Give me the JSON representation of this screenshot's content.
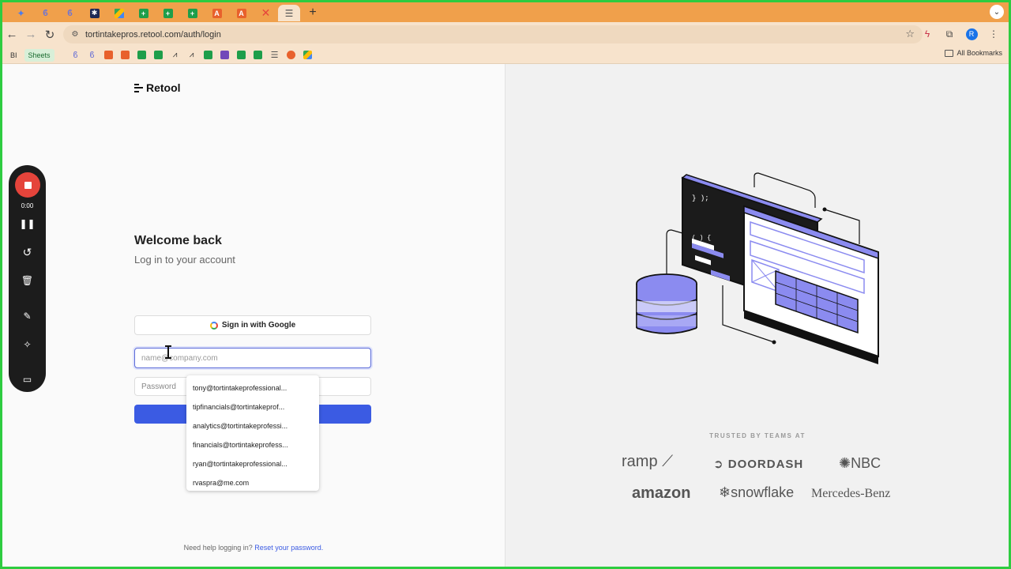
{
  "browser": {
    "tabs": [
      "Gemini",
      "Claude",
      "Claude",
      "Zapier",
      "Drive",
      "Sheets",
      "Sheets",
      "Sheets",
      "Acrobat",
      "Acrobat",
      "Close tab",
      "Retool"
    ],
    "new_tab": "+",
    "tab_menu": "⌄",
    "url": "tortintakepros.retool.com/auth/login",
    "avatar": "R",
    "bookmarks": {
      "first": "BI",
      "sheets": "Sheets",
      "all_bookmarks": "All Bookmarks"
    }
  },
  "recorder": {
    "time": "0:00"
  },
  "login": {
    "logo_text": "Retool",
    "title": "Welcome back",
    "subtitle": "Log in to your account",
    "google_button": "Sign in with Google",
    "email_placeholder": "name@company.com",
    "password_placeholder": "Password",
    "autocomplete": [
      "tony@tortintakeprofessional...",
      "tipfinancials@tortintakeprof...",
      "analytics@tortintakeprofessi...",
      "financials@tortintakeprofess...",
      "ryan@tortintakeprofessional...",
      "rvaspra@me.com"
    ],
    "help_text": "Need help logging in?",
    "help_link": "Reset your password."
  },
  "marketing": {
    "trusted_label": "TRUSTED BY TEAMS AT",
    "brands": [
      "ramp",
      "DOORDASH",
      "NBC",
      "amazon",
      "snowflake",
      "Mercedes-Benz"
    ],
    "code_line1": "} );",
    "code_line2": "( ) {"
  },
  "colors": {
    "accent": "#3b5be3",
    "illustration_purple": "#8b8bf0",
    "chrome_tab_strip": "#f0a04b",
    "record_red": "#e5443b"
  }
}
